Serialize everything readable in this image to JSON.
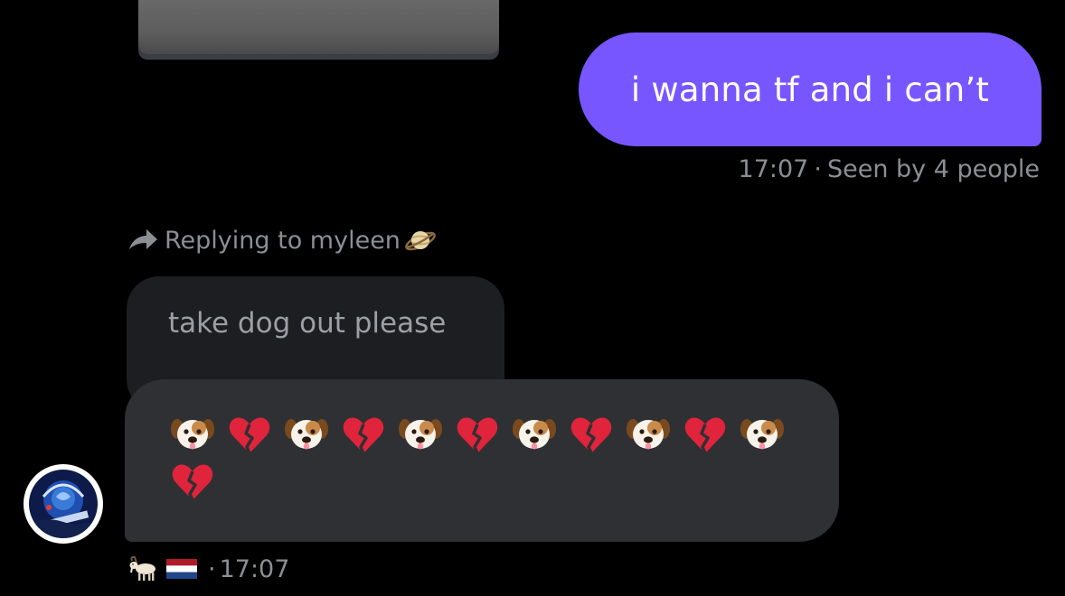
{
  "sent_message": {
    "text": "i wanna tf and i can’t",
    "time": "17:07",
    "separator": "·",
    "status": "Seen by 4 people"
  },
  "reply": {
    "label": "Replying to myleen",
    "emoji": "planet-icon"
  },
  "quoted_message": {
    "text": "take dog out please"
  },
  "received_message": {
    "emojis": [
      "dog-face",
      "broken-heart",
      "dog-face",
      "broken-heart",
      "dog-face",
      "broken-heart",
      "dog-face",
      "broken-heart",
      "dog-face",
      "broken-heart",
      "dog-face",
      "broken-heart"
    ]
  },
  "received_meta": {
    "icons": [
      "goat-icon",
      "netherlands-flag-icon"
    ],
    "separator": "·",
    "time": "17:07"
  },
  "colors": {
    "sent_bubble": "#7856ff",
    "received_bubble": "#2f3033",
    "quoted_bubble": "#1d1e21",
    "muted_text": "#8b8f94",
    "background": "#000000"
  }
}
